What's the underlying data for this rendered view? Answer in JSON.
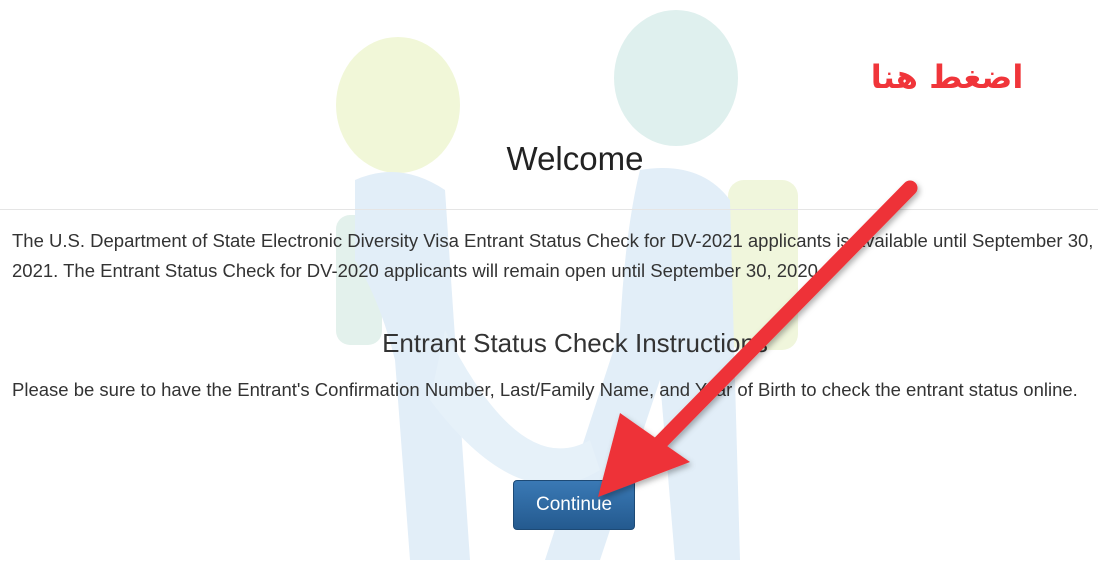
{
  "page": {
    "welcome_title": "Welcome",
    "announcement": "The U.S. Department of State Electronic Diversity Visa Entrant Status Check for DV-2021 applicants is available until September 30, 2021. The Entrant Status Check for DV-2020 applicants will remain open until September 30, 2020.",
    "instructions_heading": "Entrant Status Check Instructions",
    "instructions_text": "Please be sure to have the Entrant's Confirmation Number, Last/Family Name, and Year of Birth to check the entrant status online.",
    "continue_label": "Continue"
  },
  "annotation": {
    "text": "اضغط هنا",
    "color": "#f0353a",
    "arrow_icon": "red-arrow-icon"
  },
  "colors": {
    "button": "#2d6ca2",
    "text": "#333333",
    "divider": "#e5e5e5"
  }
}
